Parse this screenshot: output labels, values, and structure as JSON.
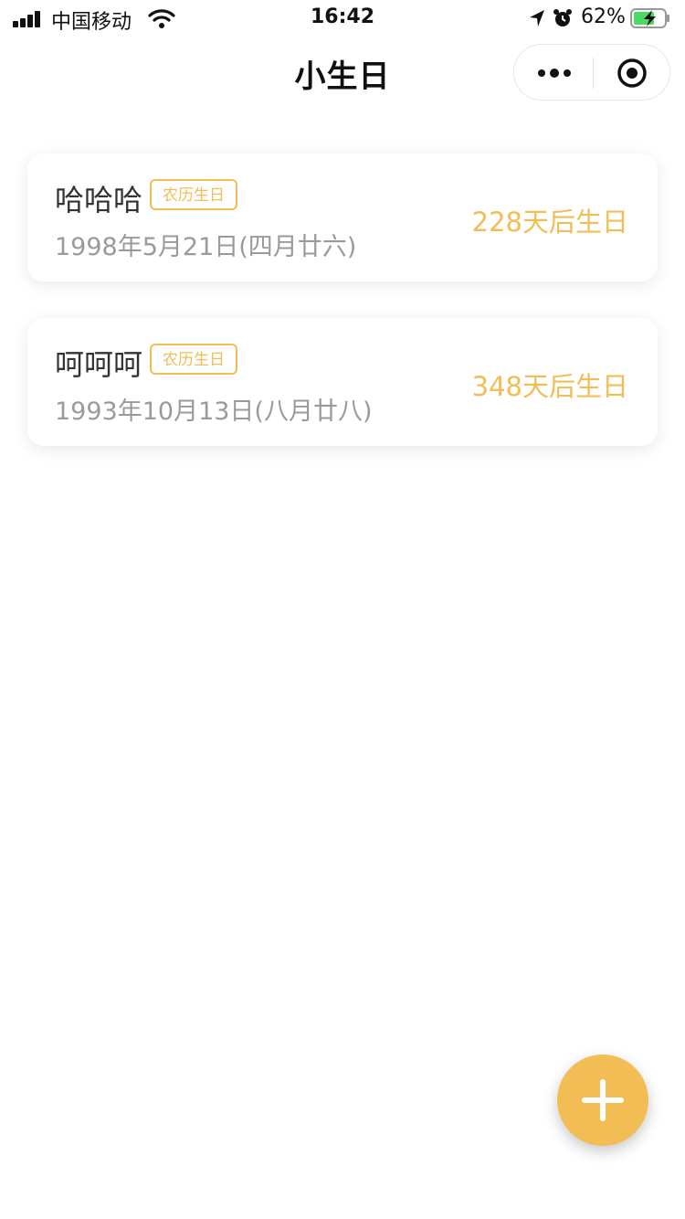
{
  "status_bar": {
    "carrier": "中国移动",
    "time": "16:42",
    "battery_percent": "62%"
  },
  "nav": {
    "title": "小生日",
    "more_icon": "more-dots-icon",
    "close_icon": "target-circle-icon"
  },
  "birthdays": [
    {
      "name": "哈哈哈",
      "tag": "农历生日",
      "date": "1998年5月21日(四月廿六)",
      "countdown": "228天后生日"
    },
    {
      "name": "呵呵呵",
      "tag": "农历生日",
      "date": "1993年10月13日(八月廿八)",
      "countdown": "348天后生日"
    }
  ],
  "fab": {
    "icon": "plus-icon"
  },
  "colors": {
    "accent": "#f2bd55",
    "text_primary": "#333333",
    "text_secondary": "#9a9a9a"
  }
}
